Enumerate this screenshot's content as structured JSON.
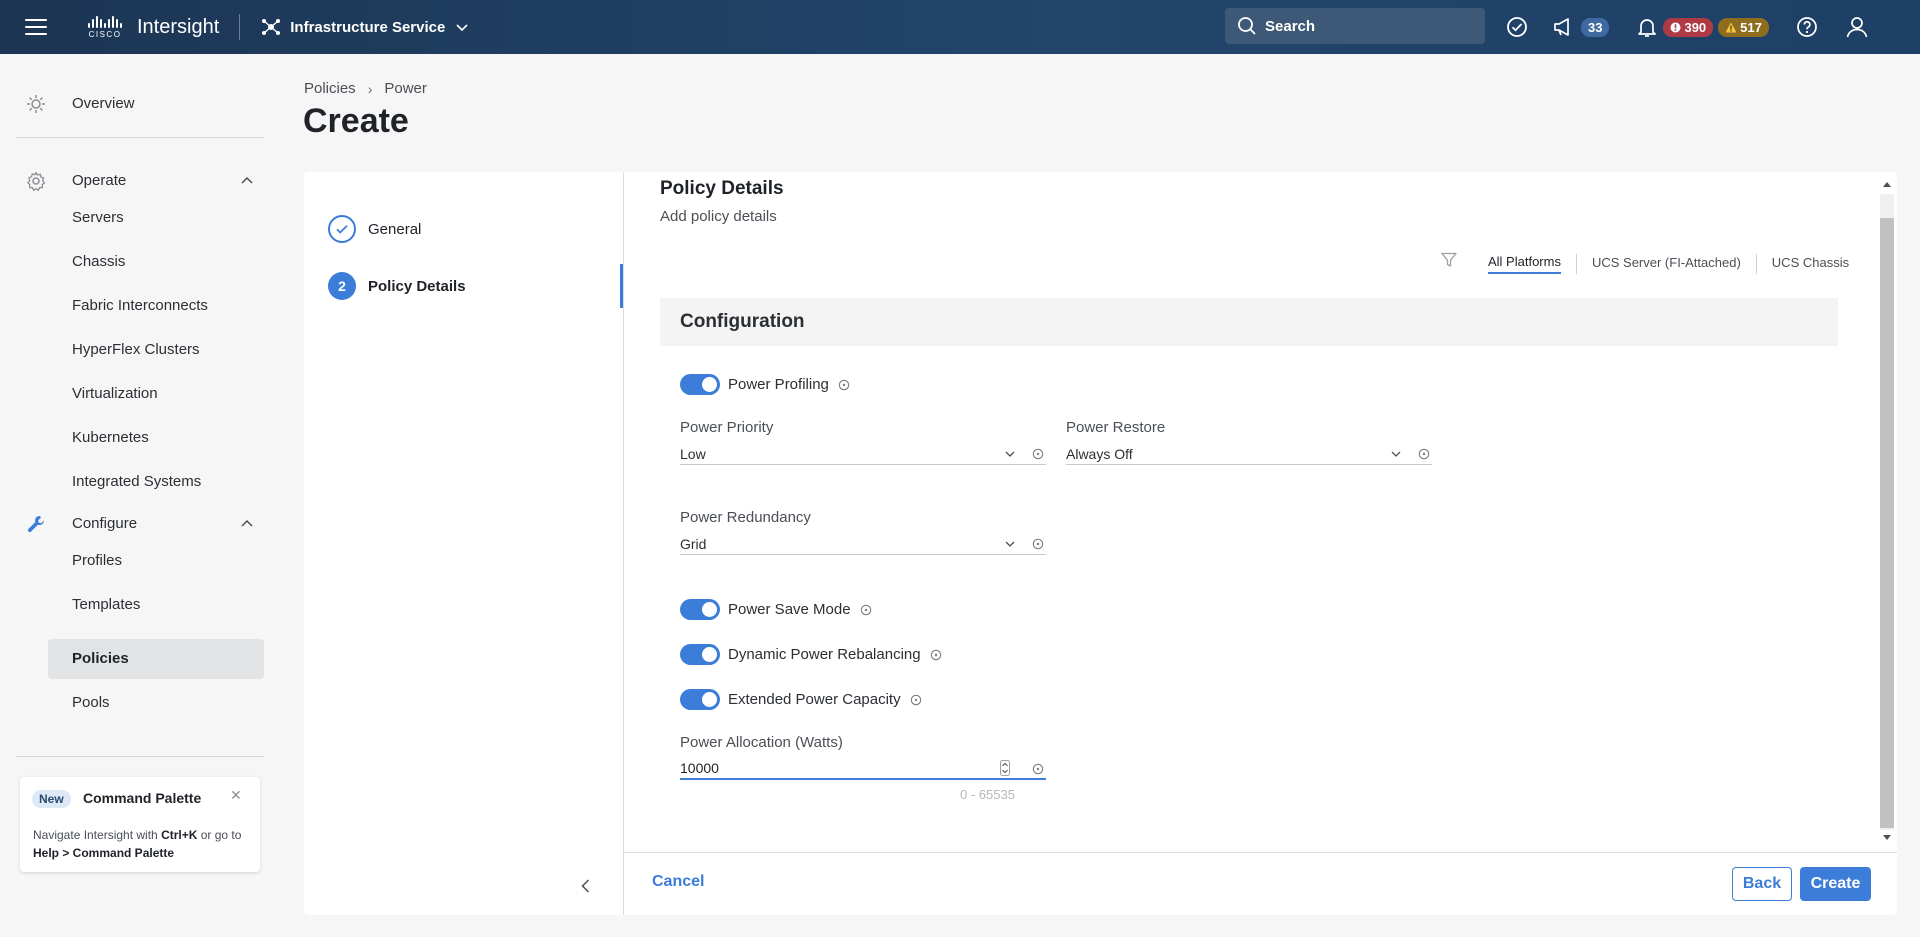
{
  "header": {
    "brand_word": "CISCO",
    "app_title": "Intersight",
    "service": "Infrastructure Service",
    "search_placeholder": "Search",
    "announcements_count": "33",
    "critical_alarms": "390",
    "warning_alarms": "517",
    "colors": {
      "header_bg": "#1c3553",
      "critical": "#b03a44",
      "warning": "#8e6d1f",
      "accent": "#3b7dd8"
    }
  },
  "sidebar": {
    "overview": "Overview",
    "operate": {
      "label": "Operate",
      "items": [
        "Servers",
        "Chassis",
        "Fabric Interconnects",
        "HyperFlex Clusters",
        "Virtualization",
        "Kubernetes",
        "Integrated Systems"
      ]
    },
    "configure": {
      "label": "Configure",
      "items": [
        "Profiles",
        "Templates",
        "Policies",
        "Pools"
      ],
      "active": "Policies"
    },
    "command_palette": {
      "new_badge": "New",
      "title": "Command Palette",
      "text_1": "Navigate Intersight with ",
      "shortcut": "Ctrl+K",
      "text_2": " or go to ",
      "path": "Help > Command Palette"
    }
  },
  "breadcrumb": {
    "parent": "Policies",
    "current": "Power"
  },
  "page_title": "Create",
  "wizard": {
    "steps": [
      {
        "label": "General",
        "state": "done"
      },
      {
        "number": "2",
        "label": "Policy Details",
        "state": "current"
      }
    ]
  },
  "policy_details": {
    "title": "Policy Details",
    "subtitle": "Add policy details",
    "platform_tabs": [
      "All Platforms",
      "UCS Server (FI-Attached)",
      "UCS Chassis"
    ],
    "active_platform": "All Platforms",
    "configuration_title": "Configuration",
    "power_profiling": {
      "label": "Power Profiling",
      "enabled": true
    },
    "power_priority": {
      "label": "Power Priority",
      "value": "Low"
    },
    "power_restore": {
      "label": "Power Restore",
      "value": "Always Off"
    },
    "power_redundancy": {
      "label": "Power Redundancy",
      "value": "Grid"
    },
    "power_save_mode": {
      "label": "Power Save Mode",
      "enabled": true
    },
    "dynamic_power_rebalancing": {
      "label": "Dynamic Power Rebalancing",
      "enabled": true
    },
    "extended_power_capacity": {
      "label": "Extended Power Capacity",
      "enabled": true
    },
    "power_allocation": {
      "label": "Power Allocation (Watts)",
      "value": "10000",
      "range_hint": "0 - 65535"
    }
  },
  "footer": {
    "cancel": "Cancel",
    "back": "Back",
    "create": "Create"
  }
}
